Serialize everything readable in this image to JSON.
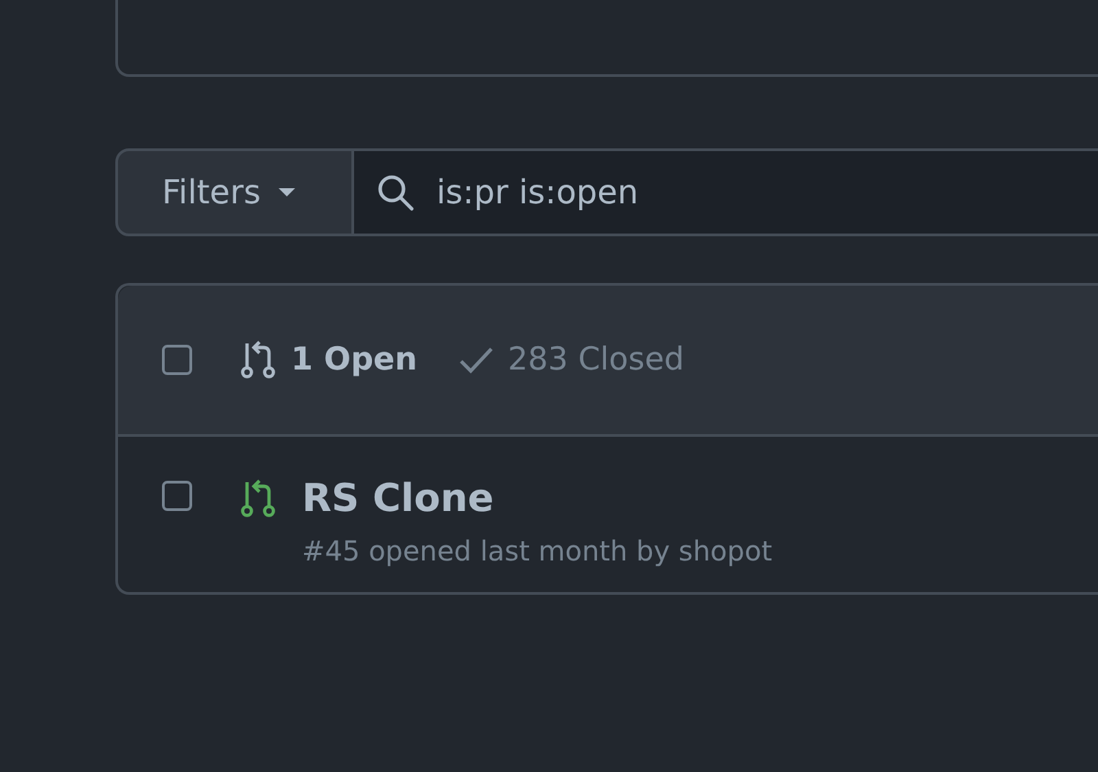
{
  "filters_button": {
    "label": "Filters"
  },
  "search": {
    "value": "is:pr is:open"
  },
  "list_header": {
    "checked": false,
    "states": [
      {
        "kind": "open",
        "label": "1 Open",
        "selected": true
      },
      {
        "kind": "closed",
        "label": "283 Closed",
        "selected": false
      }
    ]
  },
  "pull_requests": [
    {
      "title": "RS Clone",
      "meta": "#45 opened last month by shopot",
      "checked": false
    }
  ]
}
